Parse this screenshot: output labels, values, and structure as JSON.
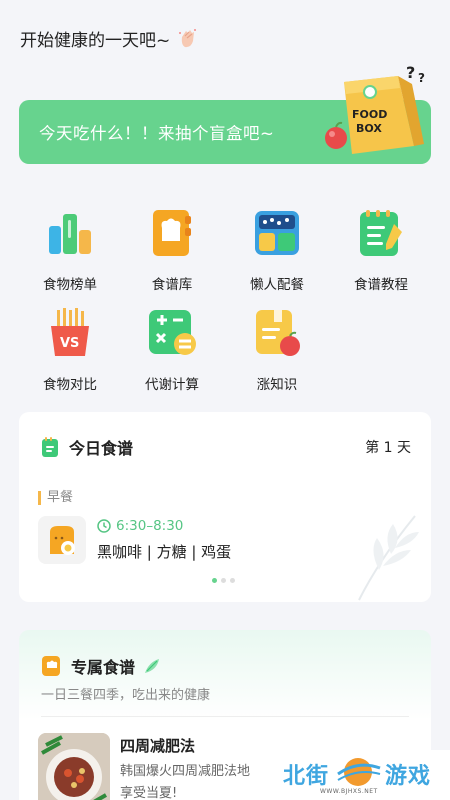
{
  "header": {
    "greeting": "开始健康的一天吧~"
  },
  "banner": {
    "text": "今天吃什么！！来抽个盲盒吧~",
    "box_label_1": "FOOD",
    "box_label_2": "BOX",
    "question": "?"
  },
  "grid": [
    {
      "label": "食物榜单",
      "icon": "food-ranking-icon"
    },
    {
      "label": "食谱库",
      "icon": "recipe-library-icon"
    },
    {
      "label": "懒人配餐",
      "icon": "lazy-meal-icon"
    },
    {
      "label": "食谱教程",
      "icon": "recipe-tutorial-icon"
    },
    {
      "label": "食物对比",
      "icon": "food-compare-icon"
    },
    {
      "label": "代谢计算",
      "icon": "metabolism-calc-icon"
    },
    {
      "label": "涨知识",
      "icon": "knowledge-icon"
    }
  ],
  "grid_vs": "VS",
  "today": {
    "title": "今日食谱",
    "day": "第 1 天",
    "meal": "早餐",
    "time": "6:30–8:30",
    "items": "黑咖啡 | 方糖 | 鸡蛋"
  },
  "exclusive": {
    "title": "专属食谱",
    "subtitle": "一日三餐四季，吃出来的健康",
    "recipe_title": "四周减肥法",
    "recipe_desc": "韩国爆火四周减肥法地享受当夏!"
  },
  "watermark": {
    "left": "北街",
    "right": "游戏",
    "url": "WWW.BJHXS.NET"
  },
  "colors": {
    "green": "#67d38e",
    "accent_orange": "#f5b74a",
    "text": "#222222"
  }
}
